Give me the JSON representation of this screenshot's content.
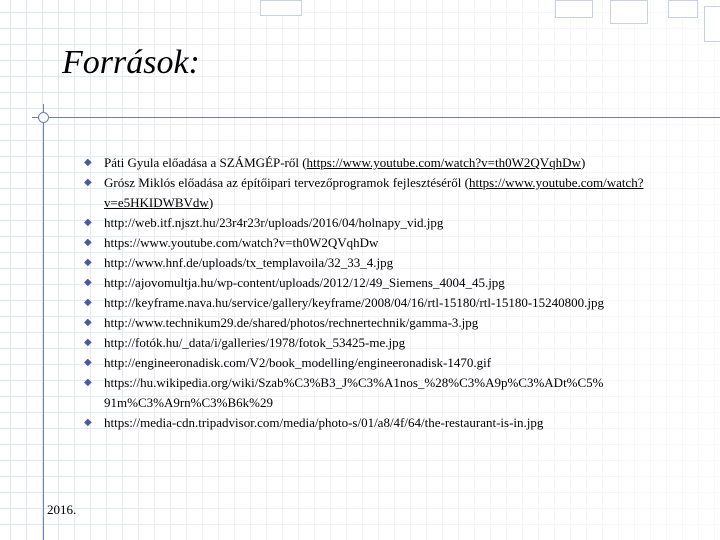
{
  "slide": {
    "title": "Források:",
    "footer": "2016.",
    "bullet_icon": "diamond-bullet",
    "accent_color": "#4b5a9a"
  },
  "sources": [
    {
      "parts": [
        {
          "text": "Páti Gyula előadása a SZÁMGÉP-ről ("
        },
        {
          "text": "https://www.youtube.com/watch?v=th0W2QVqhDw",
          "link": true
        },
        {
          "text": ")"
        }
      ]
    },
    {
      "parts": [
        {
          "text": "Grósz Miklós előadása az építőipari tervezőprogramok fejlesztéséről ("
        },
        {
          "text": "https://www.youtube.com/watch?v=e5HKIDWBVdw",
          "link": true
        },
        {
          "text": ")"
        }
      ],
      "wrap": true
    },
    {
      "parts": [
        {
          "text": "http://web.itf.njszt.hu/23r4r23r/uploads/2016/04/holnapy_vid.jpg"
        }
      ]
    },
    {
      "parts": [
        {
          "text": "https://www.youtube.com/watch?v=th0W2QVqhDw"
        }
      ]
    },
    {
      "parts": [
        {
          "text": "http://www.hnf.de/uploads/tx_templavoila/32_33_4.jpg"
        }
      ]
    },
    {
      "parts": [
        {
          "text": "http://ajovomultja.hu/wp-content/uploads/2012/12/49_Siemens_4004_45.jpg"
        }
      ]
    },
    {
      "parts": [
        {
          "text": "http://keyframe.nava.hu/service/gallery/keyframe/2008/04/16/rtl-15180/rtl-15180-15240800.jpg"
        }
      ]
    },
    {
      "parts": [
        {
          "text": "http://www.technikum29.de/shared/photos/rechnertechnik/gamma-3.jpg"
        }
      ]
    },
    {
      "parts": [
        {
          "text": "http://fotók.hu/_data/i/galleries/1978/fotok_53425-me.jpg"
        }
      ]
    },
    {
      "parts": [
        {
          "text": "http://engineeronadisk.com/V2/book_modelling/engineeronadisk-1470.gif"
        }
      ]
    },
    {
      "parts": [
        {
          "text": "https://hu.wikipedia.org/wiki/Szab%C3%B3_J%C3%A1nos_%28%C3%A9p%C3%ADt%C5%91m%C3%A9rn%C3%B6k%29"
        }
      ],
      "wrap": true,
      "break_after": 73
    },
    {
      "parts": [
        {
          "text": "https://media-cdn.tripadvisor.com/media/photo-s/01/a8/4f/64/the-restaurant-is-in.jpg"
        }
      ]
    }
  ]
}
